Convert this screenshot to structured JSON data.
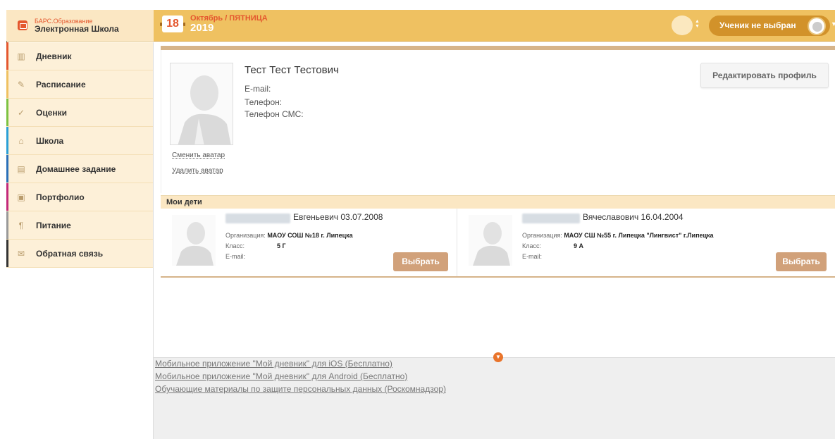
{
  "logo": {
    "line1": "БАРС.Образование",
    "line2": "Электронная Школа"
  },
  "header": {
    "day": "18",
    "month_weekday": "Октябрь / ПЯТНИЦА",
    "year": "2019",
    "student_selector": "Ученик не выбран"
  },
  "sidebar": {
    "items": [
      {
        "label": "Дневник",
        "icon": "book-icon",
        "color": "#e4572e"
      },
      {
        "label": "Расписание",
        "icon": "pencil-icon",
        "color": "#efc161"
      },
      {
        "label": "Оценки",
        "icon": "check-icon",
        "color": "#7cc242"
      },
      {
        "label": "Школа",
        "icon": "school-icon",
        "color": "#2a9fd6"
      },
      {
        "label": "Домашнее задание",
        "icon": "homework-icon",
        "color": "#2a6fb8"
      },
      {
        "label": "Портфолио",
        "icon": "portfolio-icon",
        "color": "#c2287a"
      },
      {
        "label": "Питание",
        "icon": "cutlery-icon",
        "color": "#999999"
      },
      {
        "label": "Обратная связь",
        "icon": "envelope-icon",
        "color": "#333333"
      }
    ]
  },
  "profile": {
    "name": "Тест Тест Тестович",
    "email_label": "E-mail:",
    "phone_label": "Телефон:",
    "sms_label": "Телефон СМС:",
    "change_avatar": "Сменить аватар",
    "delete_avatar": "Удалить аватар",
    "edit_button": "Редактировать профиль"
  },
  "children": {
    "title": "Мои дети",
    "org_label": "Организация:",
    "class_label": "Класс:",
    "email_label": "E-mail:",
    "choose_button": "Выбрать",
    "items": [
      {
        "name": "Евгеньевич 03.07.2008",
        "org": "МАОУ СОШ №18 г. Липецка",
        "class": "5 Г"
      },
      {
        "name": "Вячеславович 16.04.2004",
        "org": "МАОУ СШ №55 г. Липецка \"Лингвист\" г.Липецка",
        "class": "9 А"
      }
    ]
  },
  "footer": {
    "links": [
      "Мобильное приложение \"Мой дневник\" для iOS (Бесплатно)",
      "Мобильное приложение \"Мой дневник\" для Android (Бесплатно)",
      "Обучающие материалы по защите персональных данных (Роскомнадзор)"
    ]
  }
}
